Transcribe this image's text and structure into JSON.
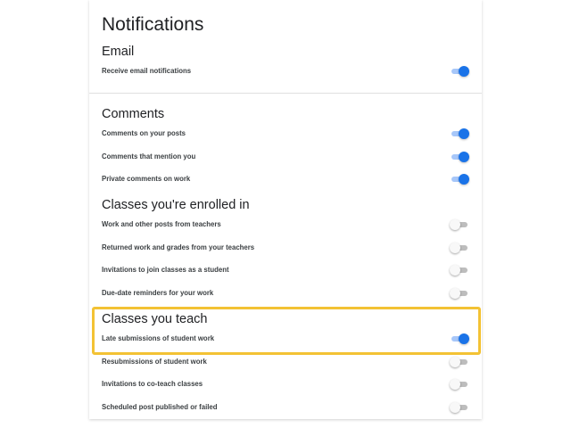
{
  "page": {
    "title": "Notifications"
  },
  "colors": {
    "accent": "#1a73e8",
    "highlight": "#f3c234"
  },
  "sections": {
    "email": {
      "title": "Email",
      "rows": [
        {
          "label": "Receive email notifications",
          "on": true
        }
      ]
    },
    "comments": {
      "title": "Comments",
      "rows": [
        {
          "label": "Comments on your posts",
          "on": true
        },
        {
          "label": "Comments that mention you",
          "on": true
        },
        {
          "label": "Private comments on work",
          "on": true
        }
      ]
    },
    "enrolled": {
      "title": "Classes you're enrolled in",
      "rows": [
        {
          "label": "Work and other posts from teachers",
          "on": false
        },
        {
          "label": "Returned work and grades from your teachers",
          "on": false
        },
        {
          "label": "Invitations to join classes as a student",
          "on": false
        },
        {
          "label": "Due-date reminders for your work",
          "on": false
        }
      ]
    },
    "teach": {
      "title": "Classes you teach",
      "rows": [
        {
          "label": "Late submissions of student work",
          "on": true
        },
        {
          "label": "Resubmissions of student work",
          "on": false
        },
        {
          "label": "Invitations to co-teach classes",
          "on": false
        },
        {
          "label": "Scheduled post published or failed",
          "on": false
        }
      ]
    }
  }
}
